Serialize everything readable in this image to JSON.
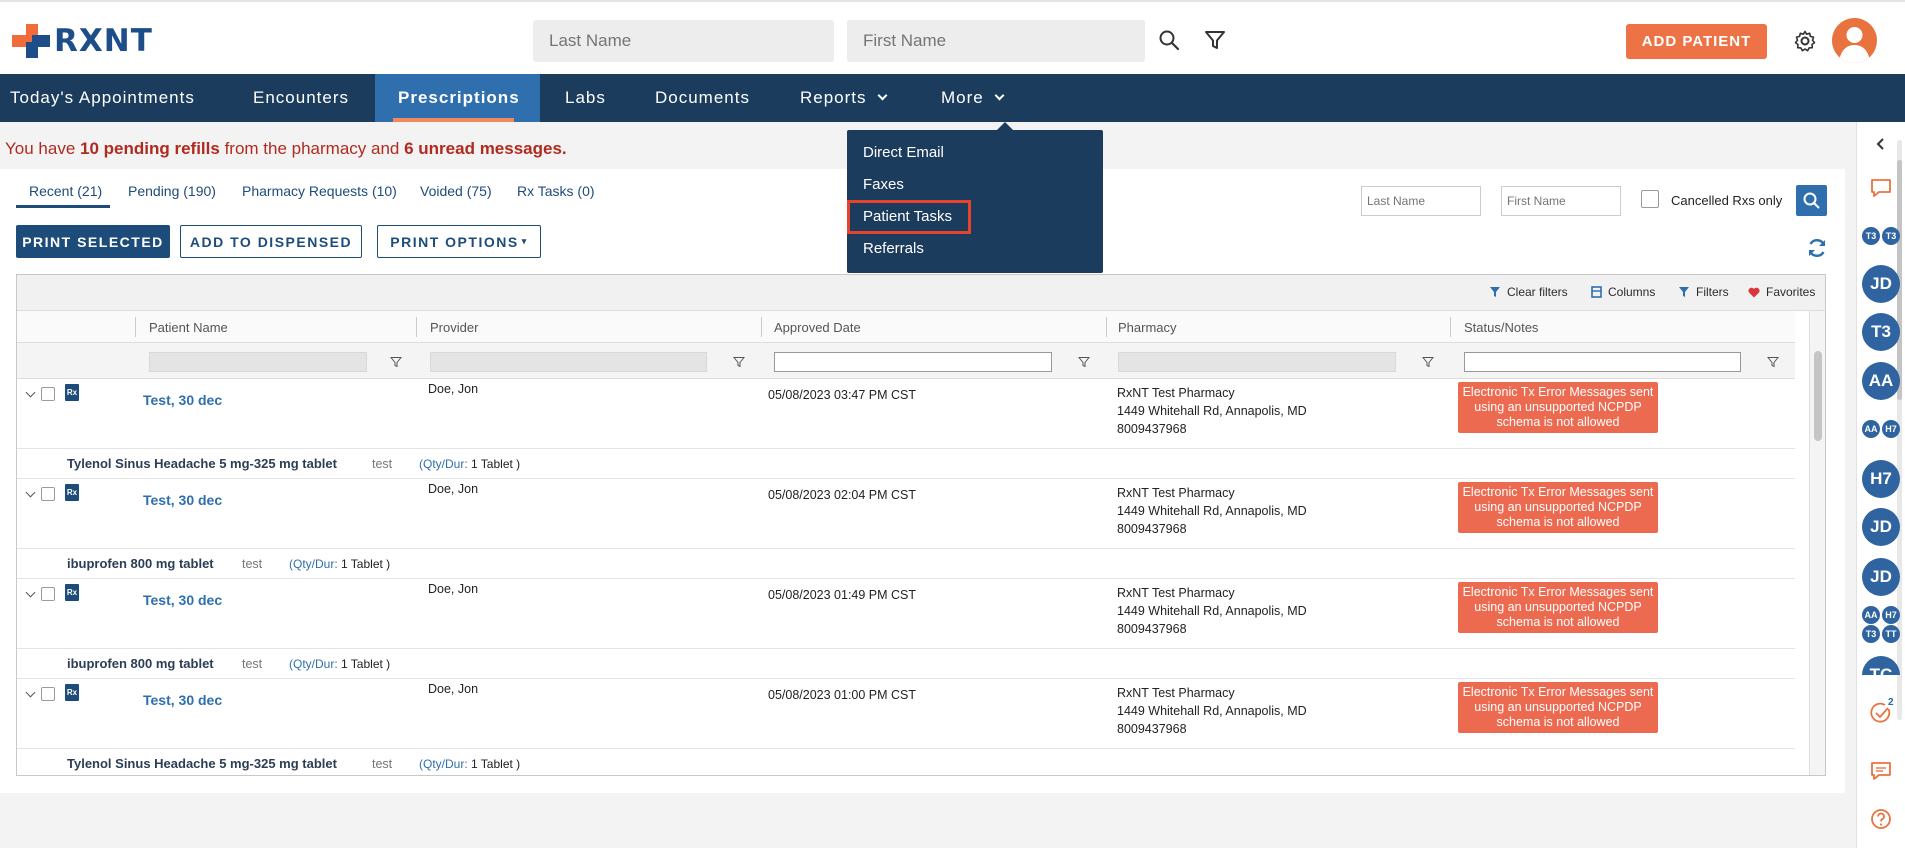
{
  "header": {
    "logo_text": "RXNT",
    "last_name_placeholder": "Last Name",
    "first_name_placeholder": "First Name",
    "add_patient_label": "ADD PATIENT",
    "accent_color": "#ed7246",
    "brand_color": "#1d4e89"
  },
  "nav": {
    "items": [
      {
        "label": "Today's Appointments"
      },
      {
        "label": "Encounters"
      },
      {
        "label": "Prescriptions"
      },
      {
        "label": "Labs"
      },
      {
        "label": "Documents"
      },
      {
        "label": "Reports"
      },
      {
        "label": "More"
      }
    ],
    "active": "Prescriptions"
  },
  "more_menu": {
    "items": [
      {
        "label": "Direct Email"
      },
      {
        "label": "Faxes"
      },
      {
        "label": "Patient Tasks"
      },
      {
        "label": "Referrals"
      }
    ],
    "highlighted": "Patient Tasks"
  },
  "alert": {
    "prefix": "You have",
    "refills": "10 pending refills",
    "middle": "from the pharmacy and",
    "messages": "6 unread messages."
  },
  "tabs": [
    {
      "label": "Recent (21)"
    },
    {
      "label": "Pending (190)"
    },
    {
      "label": "Pharmacy Requests (10)"
    },
    {
      "label": "Voided (75)"
    },
    {
      "label": "Rx Tasks (0)"
    }
  ],
  "filters": {
    "last_name_placeholder": "Last Name",
    "first_name_placeholder": "First Name",
    "cancelled_label": "Cancelled Rxs only"
  },
  "actions": {
    "print_selected": "PRINT SELECTED",
    "add_to_dispensed": "ADD TO DISPENSED",
    "print_options": "PRINT OPTIONS"
  },
  "toolbar": {
    "clear_filters": "Clear filters",
    "columns": "Columns",
    "filters": "Filters",
    "favorites": "Favorites"
  },
  "columns": [
    "Patient Name",
    "Provider",
    "Approved Date",
    "Pharmacy",
    "Status/Notes"
  ],
  "rows": [
    {
      "patient": "Test, 30 dec",
      "provider": "Doe, Jon",
      "approved": "05/08/2023 03:47 PM CST",
      "pharmacy_name": "RxNT Test Pharmacy",
      "pharmacy_address": "1449 Whitehall Rd, Annapolis, MD",
      "pharmacy_phone": "8009437968",
      "status": "Electronic Tx Error Messages sent using an unsupported NCPDP schema is not allowed",
      "drug": "Tylenol Sinus Headache 5 mg-325 mg tablet",
      "note": "test",
      "qty_label": "(Qty/Dur:",
      "qty_value": "1 Tablet )"
    },
    {
      "patient": "Test, 30 dec",
      "provider": "Doe, Jon",
      "approved": "05/08/2023 02:04 PM CST",
      "pharmacy_name": "RxNT Test Pharmacy",
      "pharmacy_address": "1449 Whitehall Rd, Annapolis, MD",
      "pharmacy_phone": "8009437968",
      "status": "Electronic Tx Error Messages sent using an unsupported NCPDP schema is not allowed",
      "drug": "ibuprofen 800 mg tablet",
      "note": "test",
      "qty_label": "(Qty/Dur:",
      "qty_value": "1 Tablet )"
    },
    {
      "patient": "Test, 30 dec",
      "provider": "Doe, Jon",
      "approved": "05/08/2023 01:49 PM CST",
      "pharmacy_name": "RxNT Test Pharmacy",
      "pharmacy_address": "1449 Whitehall Rd, Annapolis, MD",
      "pharmacy_phone": "8009437968",
      "status": "Electronic Tx Error Messages sent using an unsupported NCPDP schema is not allowed",
      "drug": "ibuprofen 800 mg tablet",
      "note": "test",
      "qty_label": "(Qty/Dur:",
      "qty_value": "1 Tablet )"
    },
    {
      "patient": "Test, 30 dec",
      "provider": "Doe, Jon",
      "approved": "05/08/2023 01:00 PM CST",
      "pharmacy_name": "RxNT Test Pharmacy",
      "pharmacy_address": "1449 Whitehall Rd, Annapolis, MD",
      "pharmacy_phone": "8009437968",
      "status": "Electronic Tx Error Messages sent using an unsupported NCPDP schema is not allowed",
      "drug": "Tylenol Sinus Headache 5 mg-325 mg tablet",
      "note": "test",
      "qty_label": "(Qty/Dur:",
      "qty_value": "1 Tablet )"
    }
  ],
  "sidebar": {
    "avatars": [
      "T3",
      "T3",
      "JD",
      "T3",
      "AA",
      "AA",
      "H7",
      "H7",
      "JD",
      "JD",
      "AA",
      "H7",
      "T3",
      "TT",
      "TC"
    ],
    "task_badge": "2",
    "avatar_color": "#2f64a0"
  }
}
